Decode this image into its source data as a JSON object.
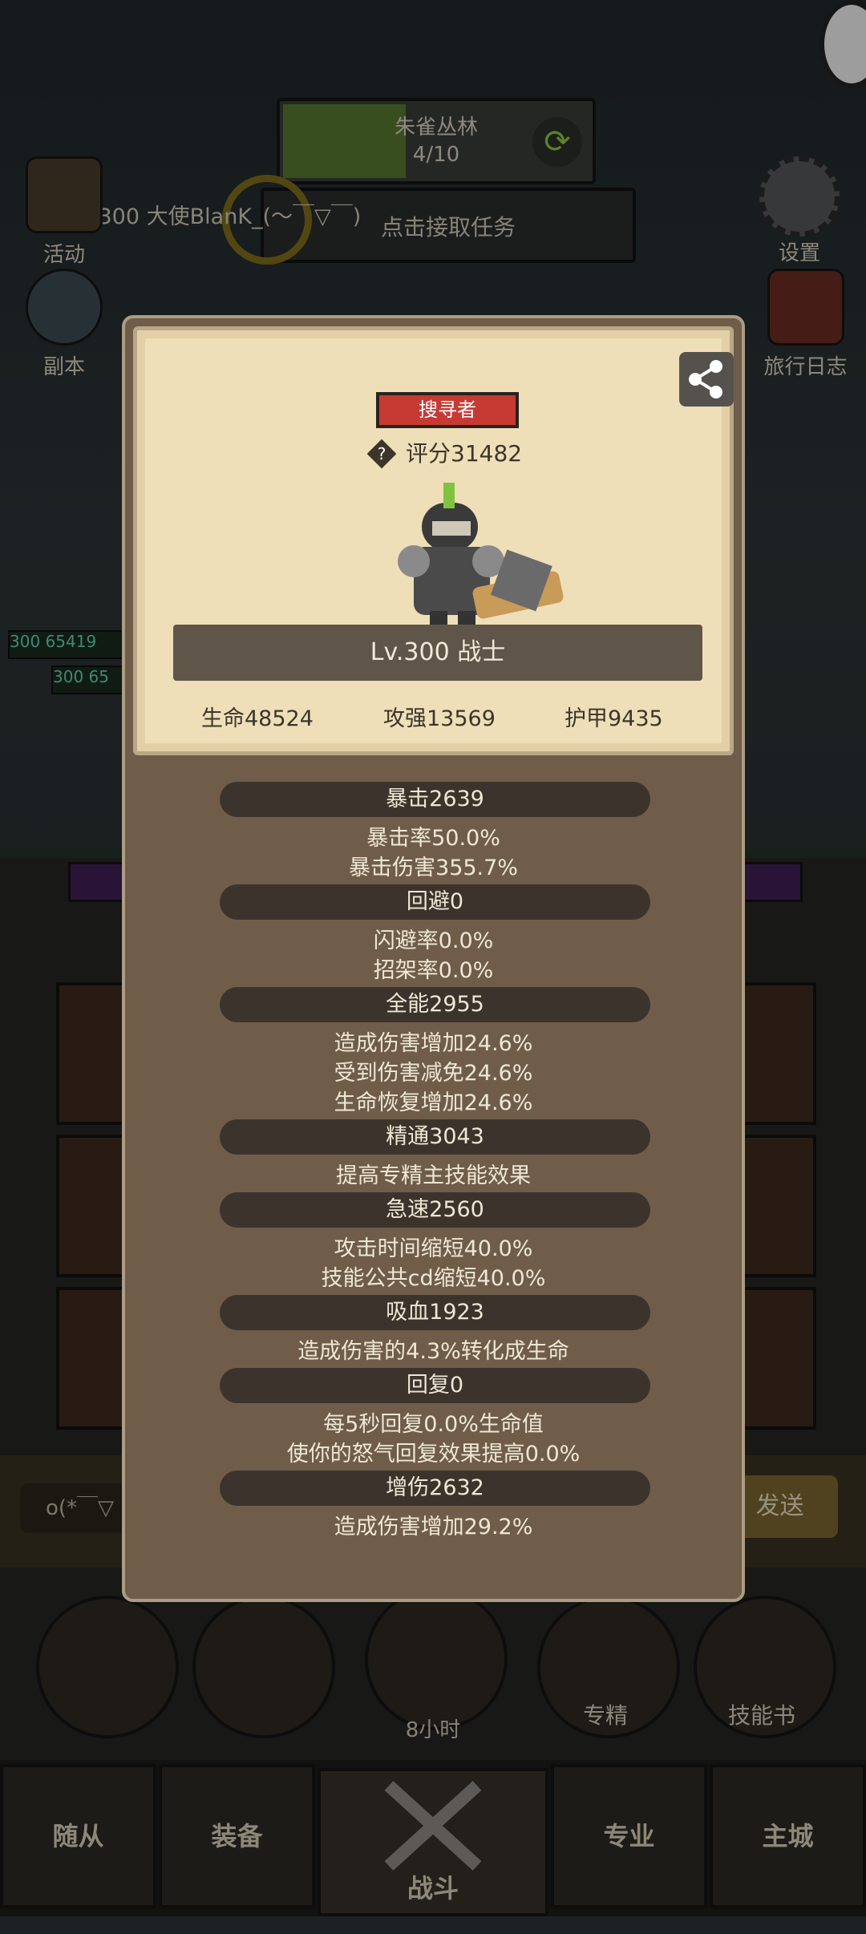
{
  "background": {
    "map_name": "朱雀丛林",
    "map_progress": "4/10",
    "map_progress_fraction": 0.4,
    "player_tag": "Lv.300 大使BlanK_(～￣▽￣)",
    "quest_label": "点击接取任务",
    "left_buttons": [
      "活动",
      "副本"
    ],
    "right_buttons": [
      "设置",
      "旅行日志"
    ],
    "enemy_levels": [
      "300",
      "300"
    ],
    "enemy_hp": [
      "65419",
      "65"
    ],
    "chat_text": "o(*￣▽",
    "send_label": "发送",
    "actions": [
      "专精",
      "技能书"
    ],
    "chest_timer": "8小时",
    "nav": [
      "随从",
      "装备",
      "战斗",
      "专业",
      "主城"
    ]
  },
  "popup": {
    "role_badge": "搜寻者",
    "score": "评分31482",
    "level_class": "Lv.300 战士",
    "base_stats": [
      {
        "label": "生命48524"
      },
      {
        "label": "攻强13569"
      },
      {
        "label": "护甲9435"
      }
    ],
    "groups": [
      {
        "header": "暴击2639",
        "lines": [
          "暴击率50.0%",
          "暴击伤害355.7%"
        ]
      },
      {
        "header": "回避0",
        "lines": [
          "闪避率0.0%",
          "招架率0.0%"
        ]
      },
      {
        "header": "全能2955",
        "lines": [
          "造成伤害增加24.6%",
          "受到伤害减免24.6%",
          "生命恢复增加24.6%"
        ]
      },
      {
        "header": "精通3043",
        "lines": [
          "提高专精主技能效果"
        ]
      },
      {
        "header": "急速2560",
        "lines": [
          "攻击时间缩短40.0%",
          "技能公共cd缩短40.0%"
        ]
      },
      {
        "header": "吸血1923",
        "lines": [
          "造成伤害的4.3%转化成生命"
        ]
      },
      {
        "header": "回复0",
        "lines": [
          "每5秒回复0.0%生命值",
          "使你的怒气回复效果提高0.0%"
        ]
      },
      {
        "header": "增伤2632",
        "lines": [
          "造成伤害增加29.2%"
        ]
      }
    ]
  }
}
